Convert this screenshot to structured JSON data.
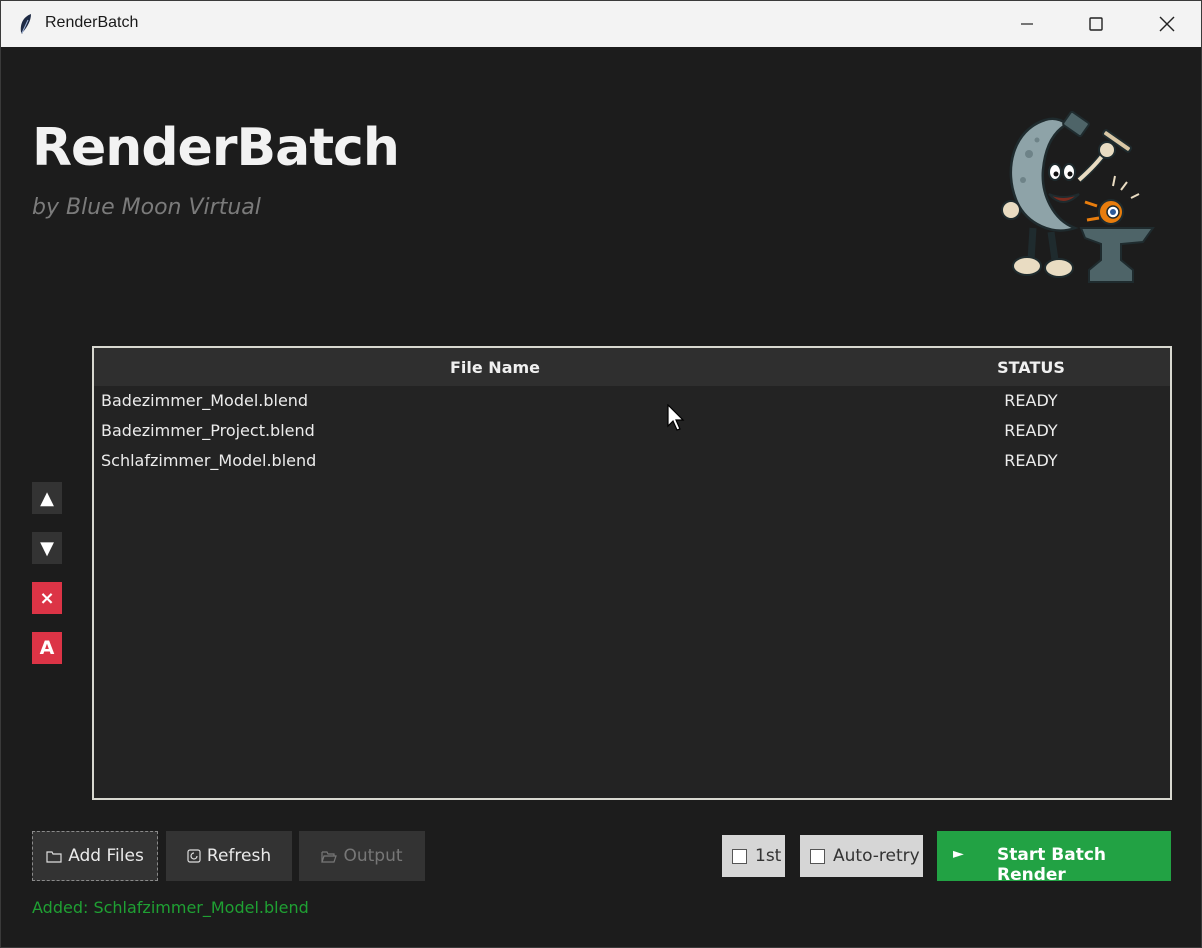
{
  "window": {
    "title": "RenderBatch"
  },
  "header": {
    "title": "RenderBatch",
    "subtitle": "by Blue Moon Virtual"
  },
  "side_controls": {
    "up_icon": "▲",
    "down_icon": "▼",
    "remove_icon": "×",
    "all_icon": "A"
  },
  "table": {
    "columns": [
      "File Name",
      "STATUS"
    ],
    "rows": [
      {
        "name": "Badezimmer_Model.blend",
        "status": "READY"
      },
      {
        "name": "Badezimmer_Project.blend",
        "status": "READY"
      },
      {
        "name": "Schlafzimmer_Model.blend",
        "status": "READY"
      }
    ]
  },
  "toolbar": {
    "add_files_label": "Add Files",
    "refresh_label": "Refresh",
    "output_label": "Output",
    "first_label": "1st",
    "auto_retry_label": "Auto-retry",
    "start_label": "Start Batch Render",
    "start_icon": "►"
  },
  "status_message": "Added: Schlafzimmer_Model.blend",
  "colors": {
    "accent_green": "#22a244",
    "danger_red": "#dc3446",
    "status_green": "#1fa033"
  }
}
